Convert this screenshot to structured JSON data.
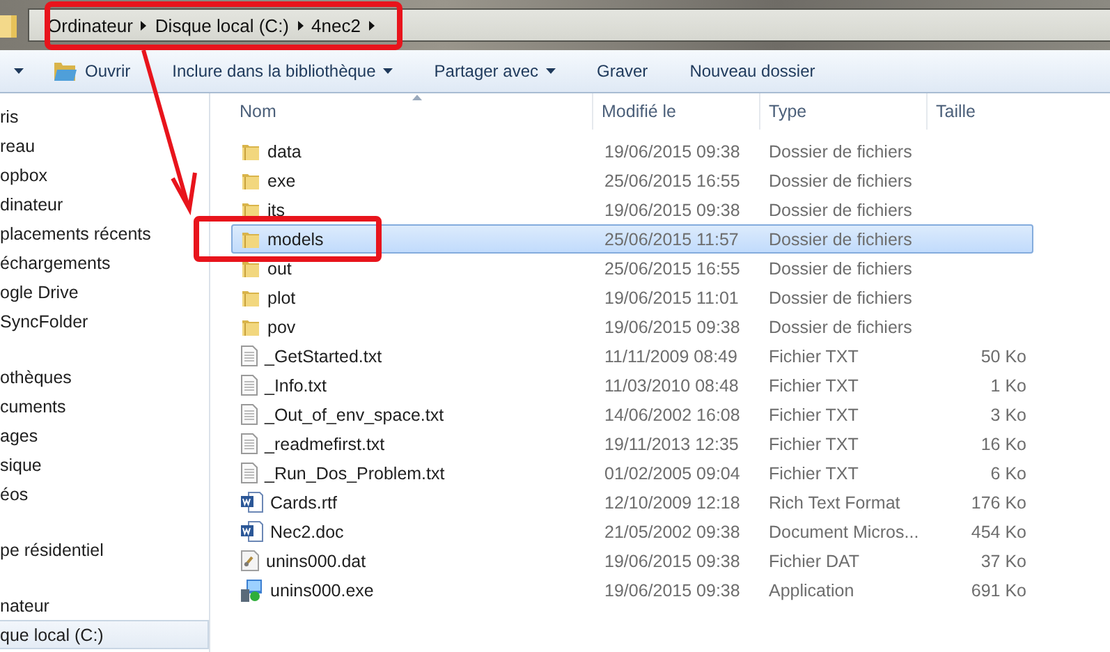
{
  "address_bar": {
    "breadcrumbs": [
      "Ordinateur",
      "Disque local (C:)",
      "4nec2"
    ]
  },
  "toolbar": {
    "items": [
      {
        "label": "Ouvrir",
        "kind": "open"
      },
      {
        "label": "Inclure dans la bibliothèque",
        "kind": "menu"
      },
      {
        "label": "Partager avec",
        "kind": "menu"
      },
      {
        "label": "Graver",
        "kind": "plain"
      },
      {
        "label": "Nouveau dossier",
        "kind": "plain"
      }
    ]
  },
  "sidebar": {
    "groups": [
      {
        "items": [
          {
            "label": "ris",
            "selected": false
          },
          {
            "label": "reau",
            "selected": false
          },
          {
            "label": "opbox",
            "selected": false
          },
          {
            "label": "dinateur",
            "selected": false
          },
          {
            "label": "placements récents",
            "selected": false
          },
          {
            "label": "échargements",
            "selected": false
          },
          {
            "label": "ogle Drive",
            "selected": false
          },
          {
            "label": "SyncFolder",
            "selected": false
          }
        ]
      },
      {
        "items": [
          {
            "label": "othèques",
            "selected": false
          },
          {
            "label": "cuments",
            "selected": false
          },
          {
            "label": "ages",
            "selected": false
          },
          {
            "label": "sique",
            "selected": false
          },
          {
            "label": "éos",
            "selected": false
          }
        ]
      },
      {
        "items": [
          {
            "label": "pe résidentiel",
            "selected": false
          }
        ]
      },
      {
        "items": [
          {
            "label": "nateur",
            "selected": false
          },
          {
            "label": "que local (C:)",
            "selected": true
          }
        ]
      }
    ]
  },
  "table": {
    "columns": [
      {
        "label": "Nom",
        "sorted": true
      },
      {
        "label": "Modifié le",
        "sorted": false
      },
      {
        "label": "Type",
        "sorted": false
      },
      {
        "label": "Taille",
        "sorted": false
      }
    ],
    "rows": [
      {
        "name": "data",
        "modified": "19/06/2015 09:38",
        "type": "Dossier de fichiers",
        "kind": "folder",
        "selected": false
      },
      {
        "name": "exe",
        "modified": "25/06/2015 16:55",
        "type": "Dossier de fichiers",
        "kind": "folder",
        "selected": false
      },
      {
        "name": "its",
        "modified": "19/06/2015 09:38",
        "type": "Dossier de fichiers",
        "kind": "folder",
        "selected": false
      },
      {
        "name": "models",
        "modified": "25/06/2015 11:57",
        "type": "Dossier de fichiers",
        "kind": "folder",
        "selected": true
      },
      {
        "name": "out",
        "modified": "25/06/2015 16:55",
        "type": "Dossier de fichiers",
        "kind": "folder",
        "selected": false
      },
      {
        "name": "plot",
        "modified": "19/06/2015 11:01",
        "type": "Dossier de fichiers",
        "kind": "folder",
        "selected": false
      },
      {
        "name": "pov",
        "modified": "19/06/2015 09:38",
        "type": "Dossier de fichiers",
        "kind": "folder",
        "selected": false
      },
      {
        "name": "_GetStarted.txt",
        "modified": "11/11/2009 08:49",
        "type": "Fichier TXT",
        "size": "50 Ko",
        "kind": "text",
        "selected": false
      },
      {
        "name": "_Info.txt",
        "modified": "11/03/2010 08:48",
        "type": "Fichier TXT",
        "size": "1 Ko",
        "kind": "text",
        "selected": false
      },
      {
        "name": "_Out_of_env_space.txt",
        "modified": "14/06/2002 16:08",
        "type": "Fichier TXT",
        "size": "3 Ko",
        "kind": "text",
        "selected": false
      },
      {
        "name": "_readmefirst.txt",
        "modified": "19/11/2013 12:35",
        "type": "Fichier TXT",
        "size": "16 Ko",
        "kind": "text",
        "selected": false
      },
      {
        "name": "_Run_Dos_Problem.txt",
        "modified": "01/02/2005 09:04",
        "type": "Fichier TXT",
        "size": "6 Ko",
        "kind": "text",
        "selected": false
      },
      {
        "name": "Cards.rtf",
        "modified": "12/10/2009 12:18",
        "type": "Rich Text Format",
        "size": "176 Ko",
        "kind": "word",
        "selected": false
      },
      {
        "name": "Nec2.doc",
        "modified": "21/05/2002 09:38",
        "type": "Document Micros...",
        "size": "454 Ko",
        "kind": "word",
        "selected": false
      },
      {
        "name": "unins000.dat",
        "modified": "19/06/2015 09:38",
        "type": "Fichier DAT",
        "size": "37 Ko",
        "kind": "dat",
        "selected": false
      },
      {
        "name": "unins000.exe",
        "modified": "19/06/2015 09:38",
        "type": "Application",
        "size": "691 Ko",
        "kind": "exe",
        "selected": false
      }
    ]
  }
}
